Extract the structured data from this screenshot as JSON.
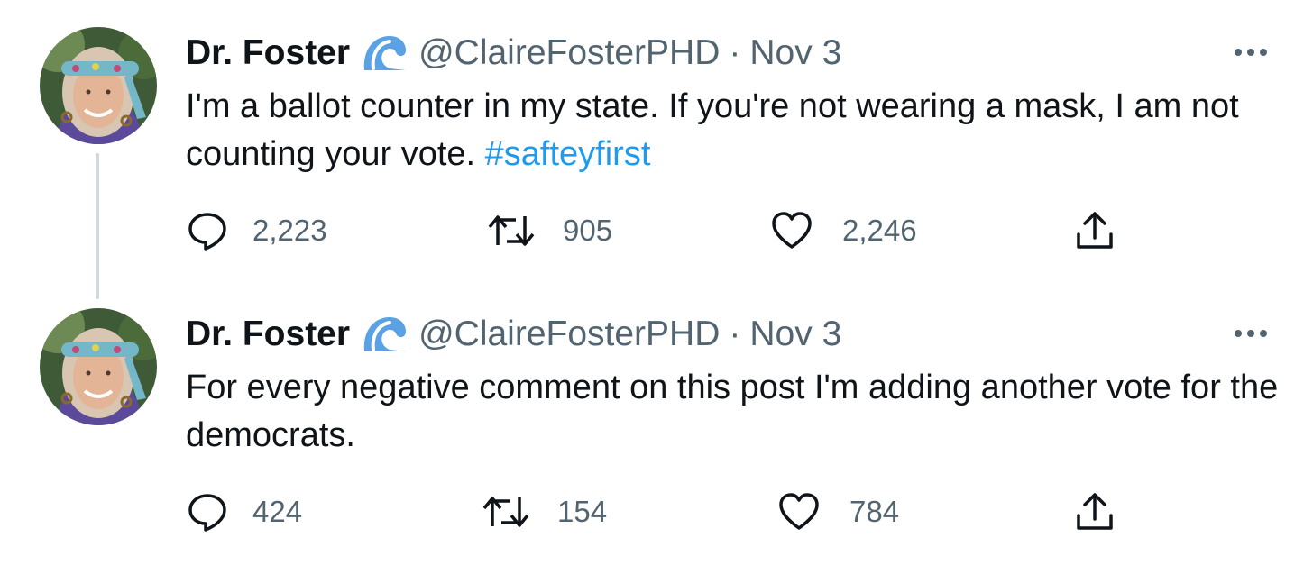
{
  "thread": {
    "tweets": [
      {
        "display_name": "Dr. Foster",
        "handle": "@ClaireFosterPHD",
        "separator": "·",
        "date": "Nov 3",
        "text": "I'm a ballot counter in my state. If you're not wearing a mask, I am not counting your vote.",
        "hashtag": "#safteyfirst",
        "replies": "2,223",
        "retweets": "905",
        "likes": "2,246"
      },
      {
        "display_name": "Dr. Foster",
        "handle": "@ClaireFosterPHD",
        "separator": "·",
        "date": "Nov 3",
        "text": "For every negative comment on this post I'm adding another vote for the democrats.",
        "hashtag": "",
        "replies": "424",
        "retweets": "154",
        "likes": "784"
      }
    ]
  },
  "icons": {
    "name_badge": "wave-emoji-icon",
    "more": "more-icon",
    "reply": "reply-icon",
    "retweet": "retweet-icon",
    "like": "heart-icon",
    "share": "share-icon"
  },
  "colors": {
    "text": "#0f1419",
    "muted": "#536471",
    "link": "#1d9bf0",
    "thread_line": "#cfd9de"
  }
}
